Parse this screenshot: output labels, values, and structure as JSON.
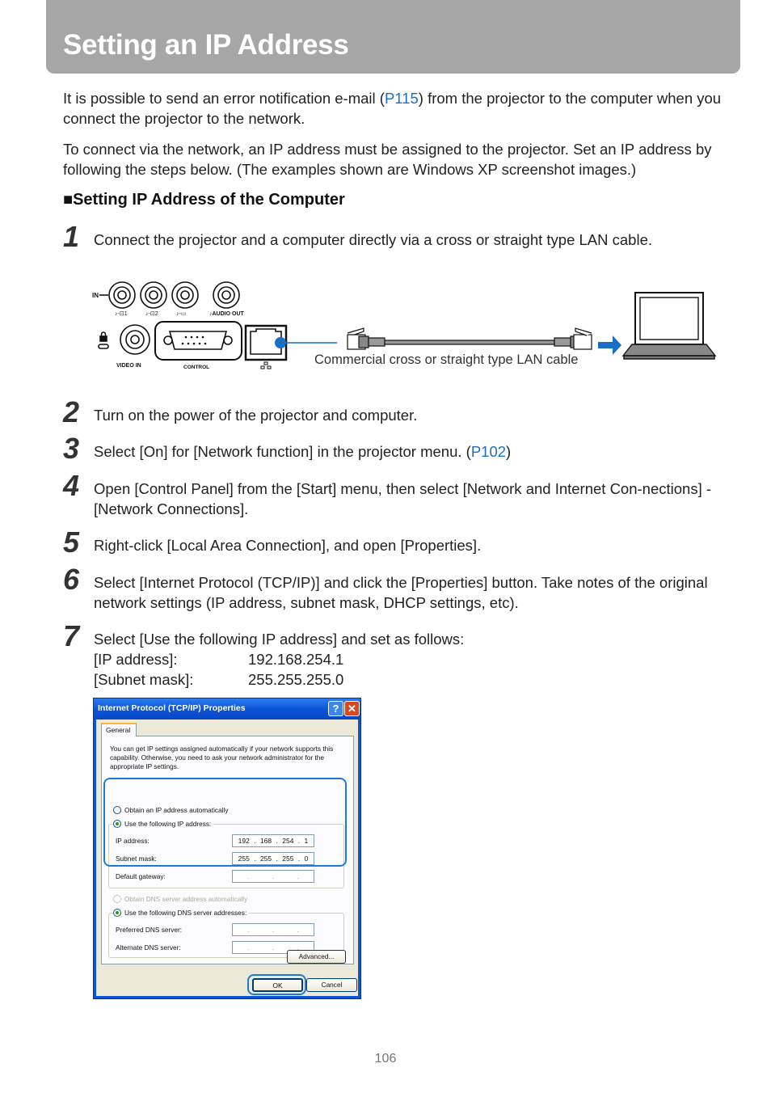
{
  "header": {
    "title": "Setting an IP Address"
  },
  "intro": [
    {
      "before": "It is possible to send an error notification e-mail (",
      "link": "P115",
      "after": ") from the projector to the computer when you connect the projector to the network."
    },
    {
      "text": "To connect via the network, an IP address must be assigned to the projector. Set an IP address by following the steps below. (The examples shown are Windows XP screenshot images.)"
    }
  ],
  "section": {
    "title": "■Setting IP Address of the Computer"
  },
  "steps": [
    {
      "num": "1",
      "text": "Connect the projector and a computer directly via a cross or straight type LAN cable."
    },
    {
      "num": "2",
      "text": "Turn on the power of the projector and computer."
    },
    {
      "num": "3",
      "before": "Select [On] for [Network function] in the projector menu. (",
      "link": "P102",
      "after": ")"
    },
    {
      "num": "4",
      "text": "Open [Control Panel] from the [Start] menu, then select [Network and Internet Con-nections] - [Network Connections]."
    },
    {
      "num": "5",
      "text": "Right-click [Local Area Connection], and open [Properties]."
    },
    {
      "num": "6",
      "text": "Select [Internet Protocol (TCP/IP)] and click the [Properties] button. Take notes of the original network settings (IP address, subnet mask, DHCP settings, etc)."
    },
    {
      "num": "7",
      "text": "Select [Use the following IP address] and set as follows:"
    }
  ],
  "settings": [
    {
      "key": "[IP address]:",
      "value": "192.168.254.1"
    },
    {
      "key": "[Subnet mask]:",
      "value": "255.255.255.0"
    }
  ],
  "diagram": {
    "labels": {
      "in": "IN",
      "audio1": "♪-⊡1",
      "audio2": "♪-⊡2",
      "audio3": "♪-▭",
      "audio_out": "♪AUDIO OUT",
      "video_in": "VIDEO IN",
      "control": "CONTROL"
    },
    "cable_label": "Commercial cross or straight type LAN cable",
    "accent_color": "#1a6fc4"
  },
  "dialog": {
    "title": "Internet Protocol (TCP/IP) Properties",
    "help": "?",
    "close": "✕",
    "tab": "General",
    "description": "You can get IP settings assigned automatically if your network supports this capability. Otherwise, you need to ask your network administrator for the appropriate IP settings.",
    "radio_auto_ip": "Obtain an IP address automatically",
    "radio_manual_ip": "Use the following IP address:",
    "ip_label": "IP address:",
    "ip_value": [
      "192",
      "168",
      "254",
      "1"
    ],
    "subnet_label": "Subnet mask:",
    "subnet_value": [
      "255",
      "255",
      "255",
      "0"
    ],
    "gateway_label": "Default gateway:",
    "empty_ip": [
      ".",
      ".",
      "."
    ],
    "radio_auto_dns": "Obtain DNS server address automatically",
    "radio_manual_dns": "Use the following DNS server addresses:",
    "preferred_dns_label": "Preferred DNS server:",
    "alternate_dns_label": "Alternate DNS server:",
    "advanced_button": "Advanced...",
    "ok_button": "OK",
    "cancel_button": "Cancel"
  },
  "footer": {
    "page_number": "106"
  }
}
